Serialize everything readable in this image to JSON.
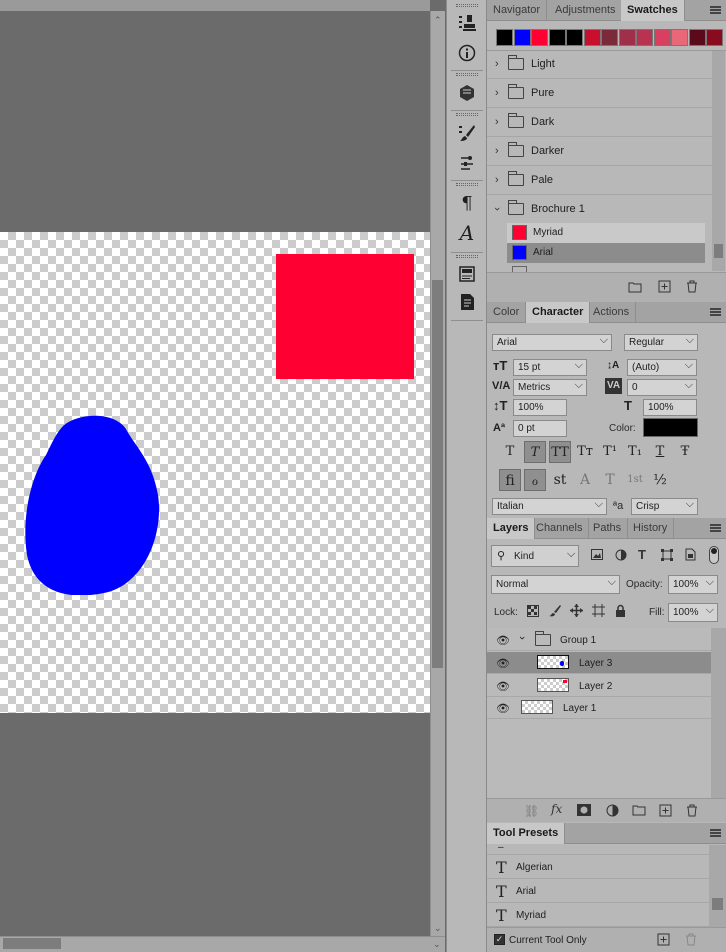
{
  "swatches_panel": {
    "tabs": [
      "Navigator",
      "Adjustments",
      "Swatches"
    ],
    "active_tab": "Swatches",
    "colors": [
      "#000000",
      "#0000ff",
      "#ff0033",
      "#000000",
      "#000000",
      "#c8102e",
      "#7b2a3a",
      "#a0304a",
      "#b8334f",
      "#d94060",
      "#e86878",
      "#5a0a1a",
      "#8a0a1e"
    ],
    "groups": [
      "Light",
      "Pure",
      "Dark",
      "Darker",
      "Pale",
      "Brochure 1"
    ],
    "brochure_items": [
      {
        "name": "Myriad",
        "color": "#ff0033"
      },
      {
        "name": "Arial",
        "color": "#0000ff"
      }
    ]
  },
  "character_panel": {
    "tabs": [
      "Color",
      "Character",
      "Actions"
    ],
    "active_tab": "Character",
    "font_family": "Arial",
    "font_style": "Regular",
    "size": "15 pt",
    "leading": "(Auto)",
    "kerning": "Metrics",
    "tracking": "0",
    "vertical_scale": "100%",
    "horizontal_scale": "100%",
    "baseline_shift": "0 pt",
    "color_label": "Color:",
    "text_color": "#000000",
    "style_buttons": [
      "T",
      "T",
      "TT",
      "Tт",
      "T¹",
      "T₁",
      "T",
      "Ŧ"
    ],
    "opentype_buttons": [
      "fi",
      "ℴ",
      "st",
      "A",
      "T",
      "1st",
      "½"
    ],
    "language": "Italian",
    "aa_label": "ªa",
    "antialias": "Crisp"
  },
  "layers_panel": {
    "tabs": [
      "Layers",
      "Channels",
      "Paths",
      "History"
    ],
    "active_tab": "Layers",
    "filter": "Kind",
    "blend_mode": "Normal",
    "opacity_label": "Opacity:",
    "opacity": "100%",
    "lock_label": "Lock:",
    "fill_label": "Fill:",
    "fill": "100%",
    "group_name": "Group 1",
    "layers": [
      {
        "name": "Layer 3",
        "selected": true
      },
      {
        "name": "Layer 2",
        "selected": false
      },
      {
        "name": "Layer 1",
        "selected": false
      }
    ]
  },
  "tool_presets_panel": {
    "title": "Tool Presets",
    "items": [
      "Algerian",
      "Arial",
      "Myriad"
    ],
    "current_tool_only_label": "Current Tool Only",
    "current_tool_only": true
  },
  "canvas": {
    "rect_color": "#ff0033",
    "blob_color": "#0000ff"
  }
}
